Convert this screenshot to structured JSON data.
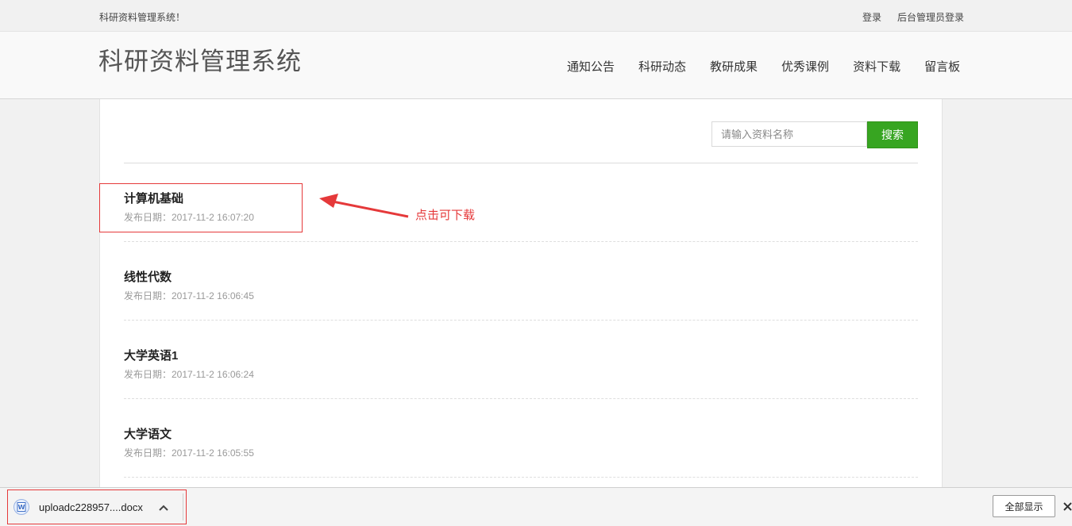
{
  "topbar": {
    "welcome": "科研资料管理系统！",
    "login_label": "登录",
    "admin_login_label": "后台管理员登录"
  },
  "header": {
    "site_title": "科研资料管理系统"
  },
  "nav": {
    "items": [
      {
        "label": "通知公告"
      },
      {
        "label": "科研动态"
      },
      {
        "label": "教研成果"
      },
      {
        "label": "优秀课例"
      },
      {
        "label": "资料下载"
      },
      {
        "label": "留言板"
      }
    ]
  },
  "search": {
    "placeholder": "请输入资料名称",
    "value": "",
    "button_label": "搜索"
  },
  "materials": [
    {
      "title": "计算机基础",
      "date": "发布日期：2017-11-2 16:07:20"
    },
    {
      "title": "线性代数",
      "date": "发布日期：2017-11-2 16:06:45"
    },
    {
      "title": "大学英语1",
      "date": "发布日期：2017-11-2 16:06:24"
    },
    {
      "title": "大学语文",
      "date": "发布日期：2017-11-2 16:05:55"
    }
  ],
  "annotation": {
    "text": "点击可下载",
    "color": "#e5393a"
  },
  "download_bar": {
    "file_name": "uploadc228957....docx",
    "file_icon": "word-document-icon",
    "show_all_label": "全部显示",
    "close_icon": "close-icon"
  },
  "colors": {
    "accent_green": "#37a521",
    "annotation_red": "#e5393a"
  }
}
